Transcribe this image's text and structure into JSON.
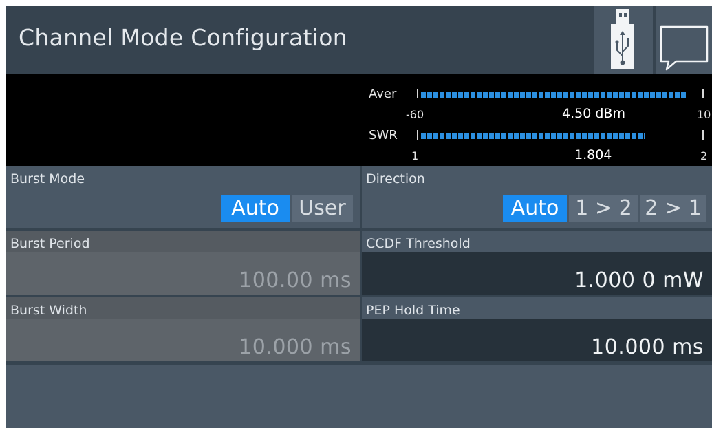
{
  "header": {
    "title": "Channel Mode Configuration",
    "usb_icon": "usb-icon",
    "message_icon": "message-icon"
  },
  "meters": {
    "aver": {
      "label": "Aver",
      "min": "-60",
      "max": "10",
      "value": "4.50 dBm",
      "level": 0.95
    },
    "swr": {
      "label": "SWR",
      "min": "1",
      "max": "2",
      "value": "1.804",
      "level": 0.8
    }
  },
  "fields": {
    "burst_mode": {
      "label": "Burst Mode",
      "options": [
        "Auto",
        "User"
      ],
      "selected": "Auto"
    },
    "direction": {
      "label": "Direction",
      "options": [
        "Auto",
        "1 > 2",
        "2 > 1"
      ],
      "selected": "Auto"
    },
    "burst_period": {
      "label": "Burst Period",
      "value": "100.00 ms"
    },
    "ccdf_threshold": {
      "label": "CCDF Threshold",
      "value": "1.000 0 mW"
    },
    "burst_width": {
      "label": "Burst Width",
      "value": "10.000 ms"
    },
    "pep_hold_time": {
      "label": "PEP Hold Time",
      "value": "10.000 ms"
    }
  },
  "colors": {
    "accent": "#1a8cf0",
    "bar": "#2b8fe0",
    "background": "#364450"
  }
}
